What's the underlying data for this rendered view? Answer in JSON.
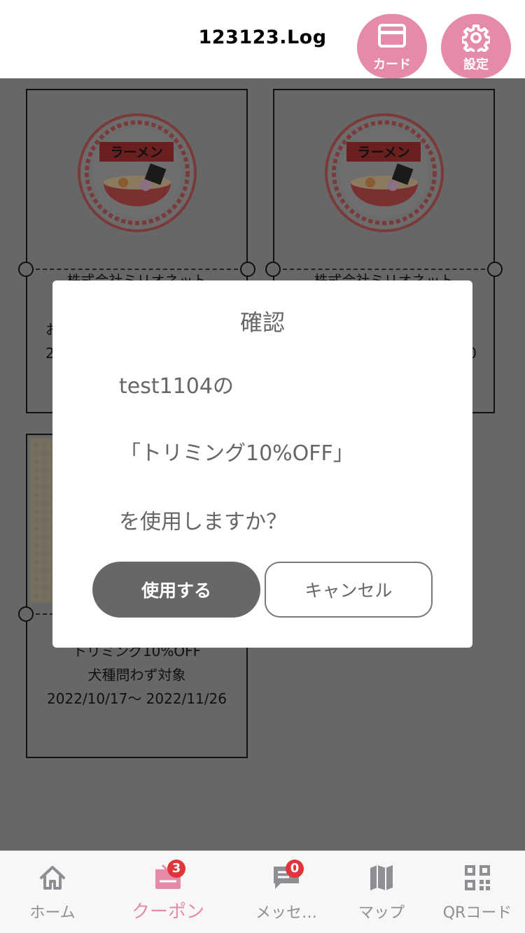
{
  "header": {
    "title": "123123.Log",
    "card_label": "カード",
    "settings_label": "設定",
    "accent": "#e58aa8"
  },
  "coupons": [
    {
      "shop": "株式会社ミリオネット",
      "line2": "お",
      "period": "2",
      "logo_text": "ラーメン"
    },
    {
      "shop": "株式会社ミリオネット",
      "period": "0",
      "logo_text": "ラーメン"
    },
    {
      "title": "トリミング10%OFF",
      "note": "犬種問わず対象",
      "period": "2022/10/17〜 2022/11/26"
    }
  ],
  "dialog": {
    "title": "確認",
    "line1": "test1104の",
    "line2": "「トリミング10%OFF」",
    "line3": "を使用しますか？",
    "confirm_label": "使用する",
    "cancel_label": "キャンセル"
  },
  "tabbar": {
    "items": [
      {
        "label": "ホーム",
        "icon": "home-icon"
      },
      {
        "label": "クーポン",
        "icon": "coupon-icon",
        "badge": "3",
        "active": true
      },
      {
        "label": "メッセ…",
        "icon": "message-icon",
        "badge": "0"
      },
      {
        "label": "マップ",
        "icon": "map-icon"
      },
      {
        "label": "QRコード",
        "icon": "qr-code-icon"
      }
    ]
  }
}
